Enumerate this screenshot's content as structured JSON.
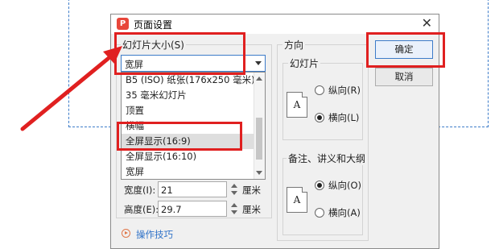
{
  "dialog": {
    "title": "页面设置",
    "app_icon": "P"
  },
  "slide_size": {
    "group_label": "幻灯片大小(S)",
    "selected_value": "宽屏",
    "options": [
      "B5 (ISO) 纸张(176x250 毫米)",
      "35 毫米幻灯片",
      "顶置",
      "横幅",
      "全屏显示(16:9)",
      "全屏显示(16:10)",
      "宽屏"
    ],
    "highlighted_option_index": 4
  },
  "width": {
    "label": "宽度(I):",
    "value": "21",
    "unit": "厘米"
  },
  "height": {
    "label": "高度(E):",
    "value": "29.7",
    "unit": "厘米"
  },
  "tips_link": "操作技巧",
  "orientation": {
    "group_label": "方向",
    "slides": {
      "label": "幻灯片",
      "portrait_label": "纵向(R)",
      "landscape_label": "横向(L)",
      "selected": "横向(L)"
    },
    "notes": {
      "label": "备注、讲义和大纲",
      "portrait_label": "纵向(O)",
      "landscape_label": "横向(A)",
      "selected": "纵向(O)"
    },
    "icon_glyph": "A"
  },
  "buttons": {
    "ok": "确定",
    "cancel": "取消"
  },
  "colors": {
    "highlight": "#e02020",
    "link": "#2f72c8",
    "accent": "#3d7cc9"
  },
  "icons": [
    "wps-presentation-icon",
    "close-icon",
    "dropdown-arrow-icon",
    "spin-up-icon",
    "spin-down-icon",
    "play-circle-icon",
    "portrait-page-icon",
    "landscape-page-icon",
    "red-annotation-arrow"
  ]
}
